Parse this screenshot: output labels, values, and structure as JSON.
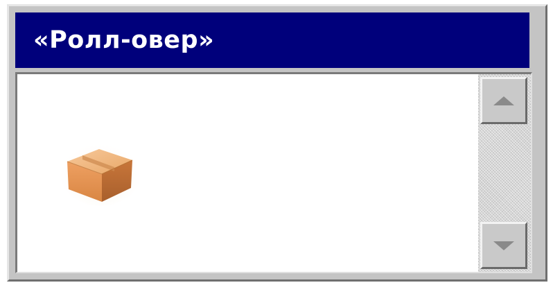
{
  "window": {
    "title": "«Ролл-овер»"
  },
  "list": {
    "items": [
      {
        "icon": "package-box-icon"
      }
    ]
  },
  "scrollbar": {
    "up_icon": "scroll-up-arrow-icon",
    "down_icon": "scroll-down-arrow-icon"
  },
  "colors": {
    "titlebar_background": "#00007b",
    "title_text": "#ffffff",
    "window_chrome": "#c4c4c4",
    "content_background": "#ffffff",
    "box_icon": "#e09a55"
  }
}
